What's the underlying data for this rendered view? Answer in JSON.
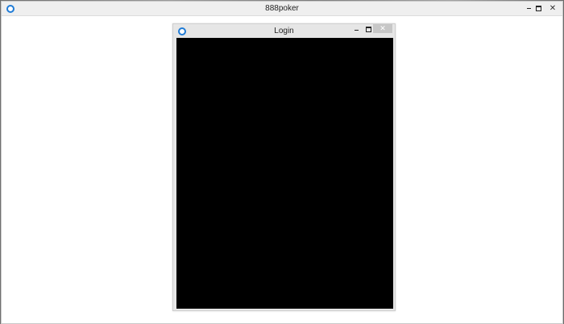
{
  "main_window": {
    "title": "888poker",
    "icon": "app-ring-icon",
    "controls": {
      "minimize": "minimize-icon",
      "maximize": "maximize-icon",
      "close": "✕"
    }
  },
  "login_window": {
    "title": "Login",
    "icon": "app-ring-icon",
    "controls": {
      "minimize": "minimize-icon",
      "maximize": "maximize-icon",
      "close": "✕"
    }
  },
  "colors": {
    "accent": "#1f7bd6",
    "content_bg": "#000000",
    "titlebar_bg": "#efefef"
  }
}
